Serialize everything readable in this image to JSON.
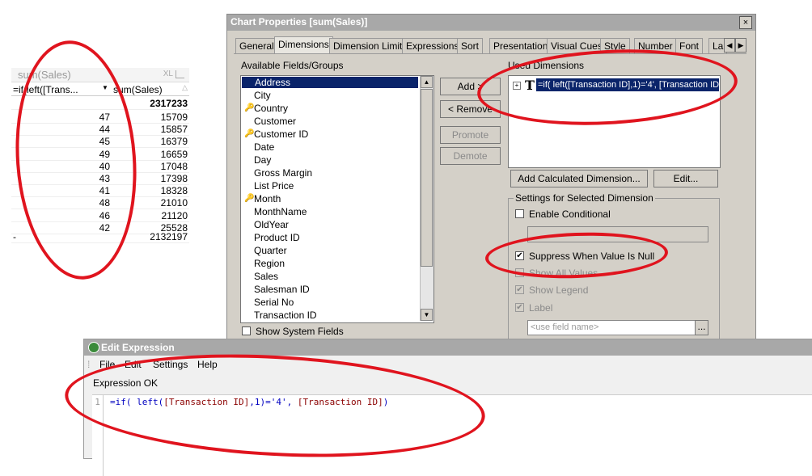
{
  "table": {
    "title": "sum(Sales)",
    "xl": "XL",
    "col1": "=if(left([Trans...",
    "col2": "sum(Sales)",
    "total": "2317233",
    "rows": [
      {
        "d": "47",
        "v": "15709"
      },
      {
        "d": "44",
        "v": "15857"
      },
      {
        "d": "45",
        "v": "16379"
      },
      {
        "d": "49",
        "v": "16659"
      },
      {
        "d": "40",
        "v": "17048"
      },
      {
        "d": "43",
        "v": "17398"
      },
      {
        "d": "41",
        "v": "18328"
      },
      {
        "d": "48",
        "v": "21010"
      },
      {
        "d": "46",
        "v": "21120"
      },
      {
        "d": "42",
        "v": "25528"
      }
    ],
    "null_dim": "-",
    "null_val": "2132197"
  },
  "dialog": {
    "title": "Chart Properties [sum(Sales)]",
    "close": "×",
    "tabs": [
      "General",
      "Dimensions",
      "Dimension Limits",
      "Expressions",
      "Sort",
      "Presentation",
      "Visual Cues",
      "Style",
      "Number",
      "Font",
      "La"
    ],
    "available_label": "Available Fields/Groups",
    "used_label": "Used Dimensions",
    "fields": [
      "Address",
      "City",
      "Country",
      "Customer",
      "Customer ID",
      "Date",
      "Day",
      "Gross Margin",
      "List Price",
      "Month",
      "MonthName",
      "OldYear",
      "Product ID",
      "Quarter",
      "Region",
      "Sales",
      "Salesman ID",
      "Serial No",
      "Transaction ID"
    ],
    "add": "Add >",
    "remove": "< Remove",
    "promote": "Promote",
    "demote": "Demote",
    "used_expr": "=if( left([Transaction ID],1)='4', [Transaction ID])",
    "add_calc": "Add Calculated Dimension...",
    "edit": "Edit...",
    "show_system": "Show System Fields",
    "settings_title": "Settings for Selected Dimension",
    "enable_conditional": "Enable Conditional",
    "suppress_null": "Suppress When Value Is Null",
    "show_all": "Show All Values",
    "show_legend": "Show Legend",
    "label": "Label",
    "label_placeholder": "<use field name>",
    "ellipsis": "..."
  },
  "edit_expr": {
    "title": "Edit Expression",
    "menu": [
      "File",
      "Edit",
      "Settings",
      "Help"
    ],
    "status": "Expression OK",
    "line_no": "1",
    "code_kw": "=if(",
    "code_fn": " left(",
    "code_f1": "[Transaction ID]",
    "code_mid": ",1)='4', ",
    "code_f2": "[Transaction ID]",
    "code_end": ")"
  },
  "colors": {
    "annotation": "#e0141e",
    "selection": "#0a246a"
  }
}
